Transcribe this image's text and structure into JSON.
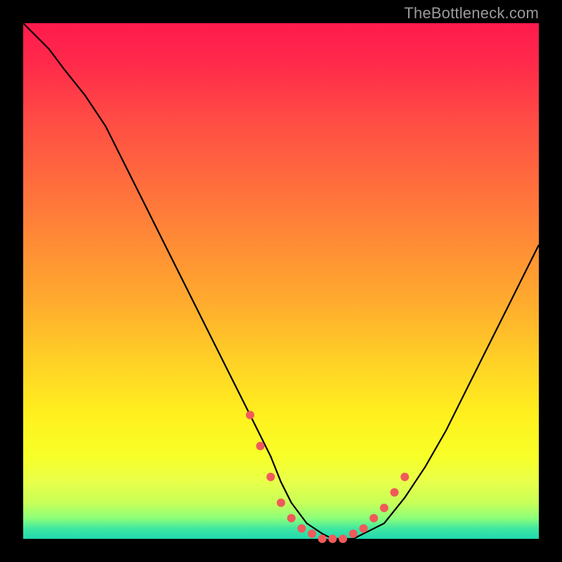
{
  "watermark": {
    "text": "TheBottleneck.com"
  },
  "colors": {
    "background": "#000000",
    "curve_stroke": "#000000",
    "marker_fill": "#f05a5a",
    "marker_stroke": "#c84040"
  },
  "chart_data": {
    "type": "line",
    "title": "",
    "xlabel": "",
    "ylabel": "",
    "xlim": [
      0,
      100
    ],
    "ylim": [
      0,
      100
    ],
    "grid": false,
    "legend": false,
    "x": [
      0,
      2,
      5,
      8,
      12,
      16,
      20,
      24,
      28,
      32,
      36,
      40,
      44,
      48,
      50,
      52,
      55,
      58,
      60,
      62,
      64,
      66,
      70,
      74,
      78,
      82,
      86,
      90,
      94,
      98,
      100
    ],
    "values": [
      100,
      98,
      95,
      91,
      86,
      80,
      72,
      64,
      56,
      48,
      40,
      32,
      24,
      16,
      11,
      7,
      3,
      1,
      0,
      0,
      0,
      1,
      3,
      8,
      14,
      21,
      29,
      37,
      45,
      53,
      57
    ],
    "markers": {
      "x": [
        44,
        46,
        48,
        50,
        52,
        54,
        56,
        58,
        60,
        62,
        64,
        66,
        68,
        70,
        72,
        74
      ],
      "y": [
        24,
        18,
        12,
        7,
        4,
        2,
        1,
        0,
        0,
        0,
        1,
        2,
        4,
        6,
        9,
        12
      ]
    }
  }
}
